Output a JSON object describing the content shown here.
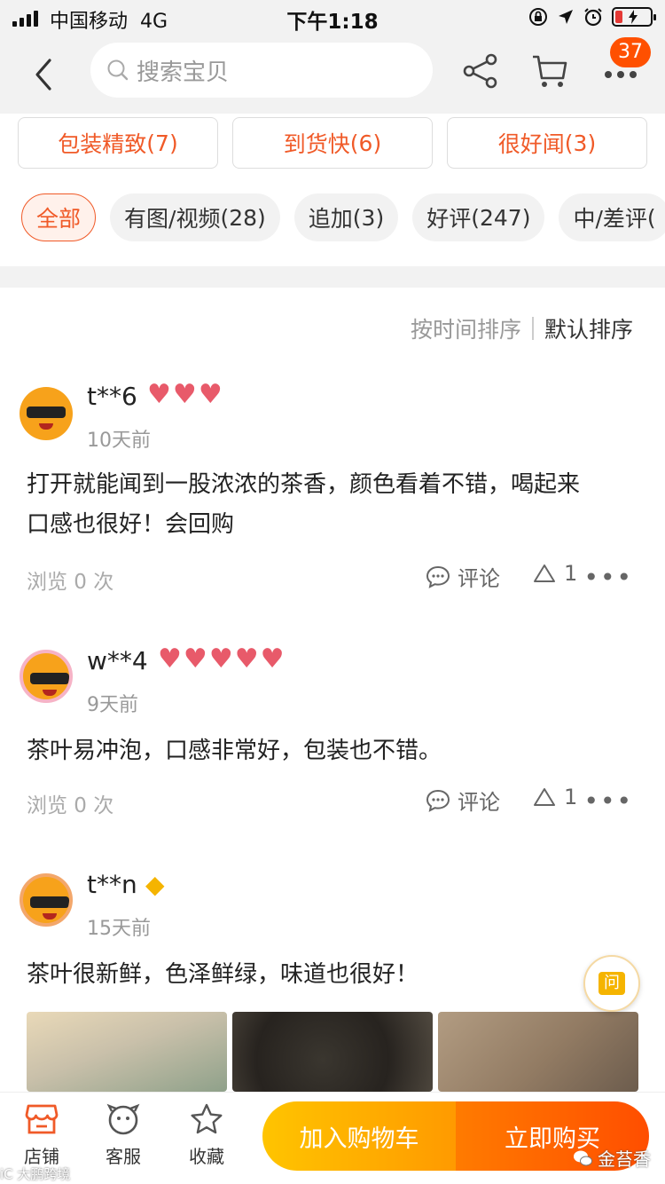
{
  "status_bar": {
    "carrier": "中国移动",
    "network": "4G",
    "time": "下午1:18"
  },
  "header": {
    "search_placeholder": "搜索宝贝",
    "badge_count": "37"
  },
  "keyword_tags": [
    {
      "label": "包装精致",
      "count": "(7)"
    },
    {
      "label": "到货快",
      "count": "(6)"
    },
    {
      "label": "很好闻",
      "count": "(3)"
    }
  ],
  "filters": [
    {
      "label": "全部",
      "count": ""
    },
    {
      "label": "有图/视频",
      "count": "(28)"
    },
    {
      "label": "追加",
      "count": "(3)"
    },
    {
      "label": "好评",
      "count": "(247)"
    },
    {
      "label": "中/差评",
      "count": "("
    }
  ],
  "sort": {
    "by_time": "按时间排序",
    "default": "默认排序"
  },
  "reviews": [
    {
      "user": "t**6",
      "level": {
        "type": "heart",
        "count": 3
      },
      "time": "10天前",
      "text_line1": "打开就能闻到一股浓浓的茶香，颜色看着不错，喝起来",
      "text_line2": "口感也很好！会回购",
      "views": "浏览 0 次",
      "comment_label": "评论",
      "likes": "1"
    },
    {
      "user": "w**4",
      "level": {
        "type": "heart",
        "count": 5
      },
      "time": "9天前",
      "text_line1": "茶叶易冲泡，口感非常好，包装也不错。",
      "views": "浏览 0 次",
      "comment_label": "评论",
      "likes": "1"
    },
    {
      "user": "t**n",
      "level": {
        "type": "diamond",
        "count": 1
      },
      "time": "15天前",
      "text_line1": "茶叶很新鲜，色泽鲜绿，味道也很好！"
    }
  ],
  "ask_button": "问",
  "bottom_bar": {
    "store": "店铺",
    "service": "客服",
    "favorite": "收藏",
    "add_to_cart": "加入购物车",
    "buy_now": "立即购买"
  },
  "watermarks": {
    "left": "iC 大鹏跨境",
    "right": "金苔香"
  },
  "colors": {
    "accent": "#f05a28",
    "badge": "#ff5000",
    "heart": "#e85a6a",
    "diamond": "#f5b400"
  }
}
